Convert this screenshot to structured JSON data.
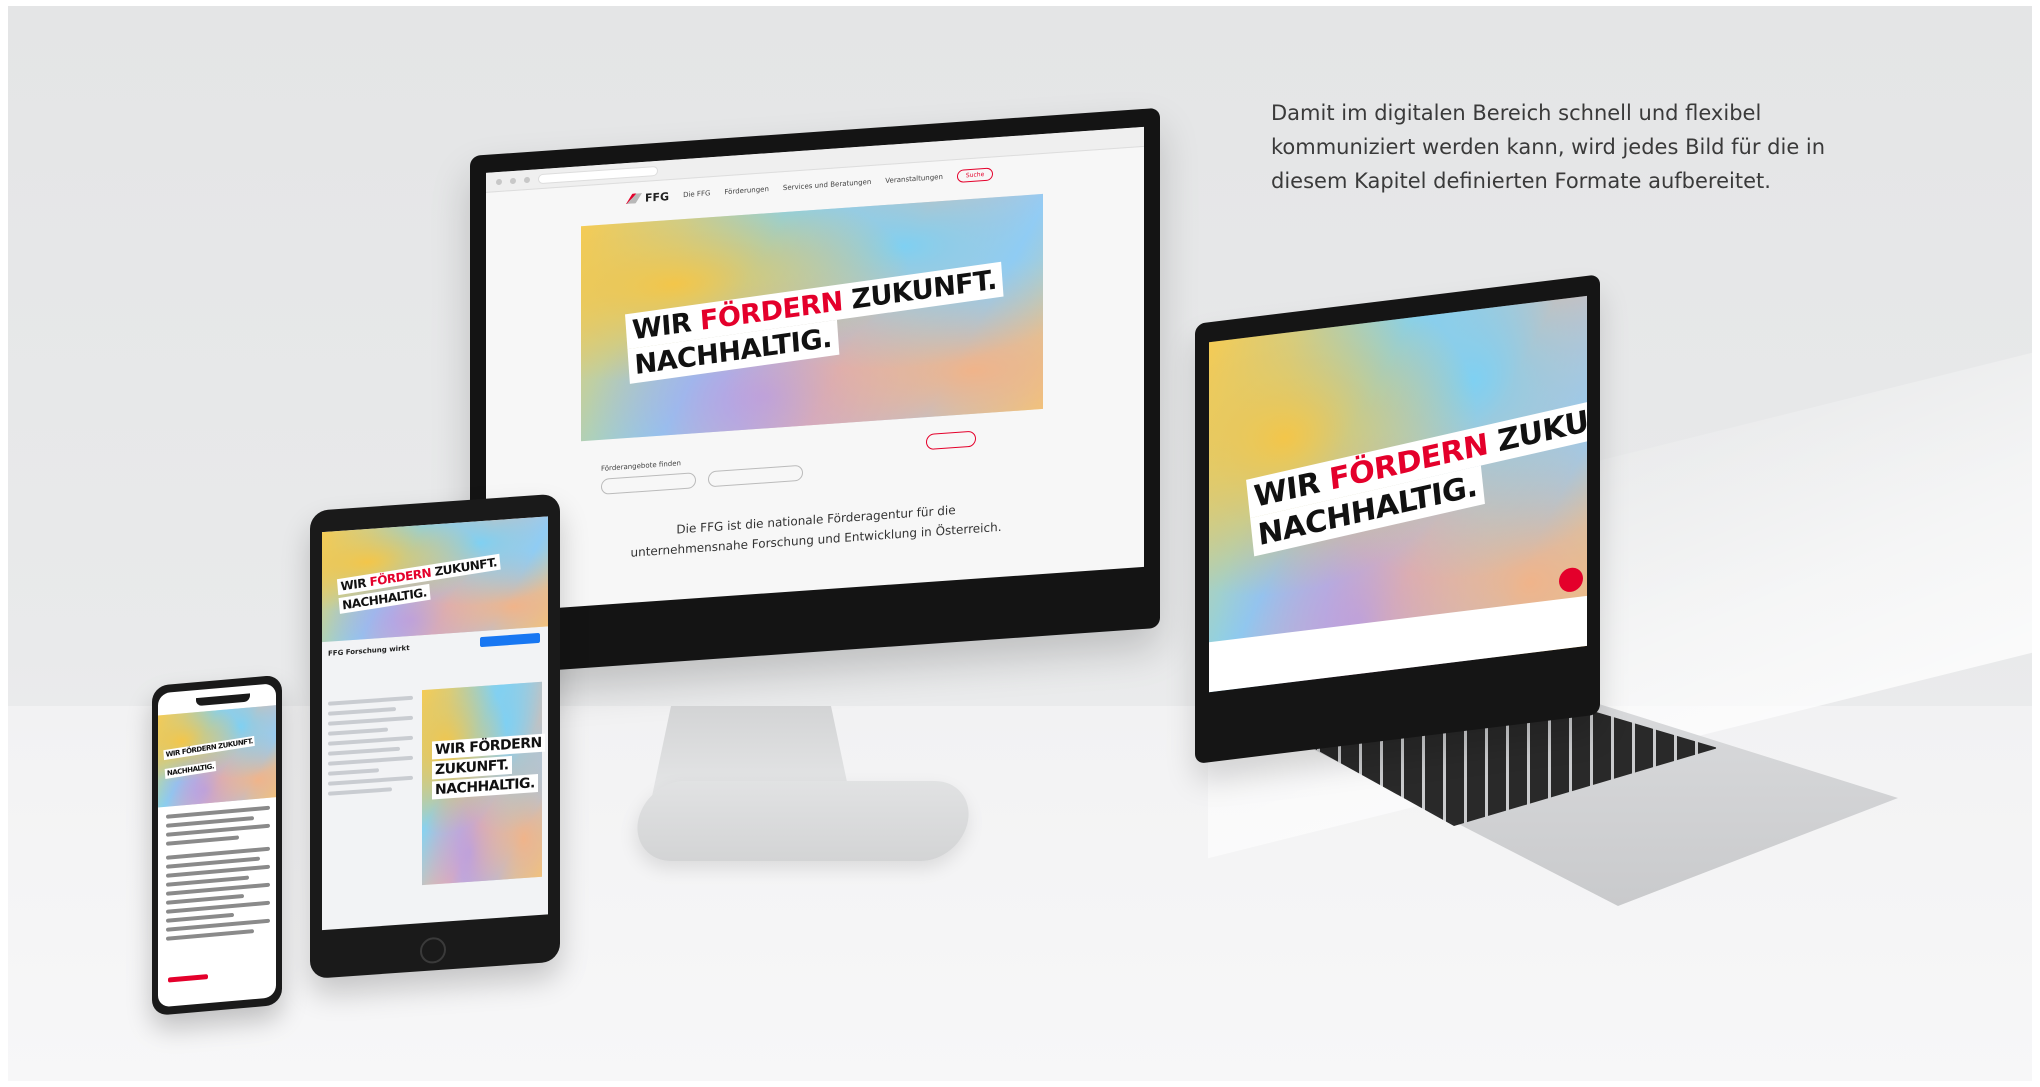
{
  "caption": {
    "line1": "Damit im digitalen Bereich schnell und flexibel",
    "line2": "kommuniziert werden kann, wird jedes Bild für die in",
    "line3": "diesem Kapitel definierten Formate aufbereitet."
  },
  "headline": {
    "word1": "WIR",
    "word2": "FÖRDERN",
    "word3": "ZUKUNFT.",
    "line2": "NACHHALTIG."
  },
  "monitor": {
    "logo": "FFG",
    "nav": [
      "Die FFG",
      "Förderungen",
      "Services und Beratungen",
      "Veranstaltungen"
    ],
    "nav_button": "Suche",
    "search_label": "Förderangebote finden",
    "tagline": "Die FFG ist die nationale Förderagentur für die unternehmensnahe Forschung und Entwicklung in Österreich."
  },
  "tablet": {
    "page_name": "FFG Forschung wirkt",
    "post_line1": "WIR FÖRDERN",
    "post_line2": "ZUKUNFT.",
    "post_line3": "NACHHALTIG."
  },
  "phone": {
    "hl1": "WIR FÖRDERN ZUKUNFT.",
    "hl2": "NACHHALTIG."
  },
  "colors": {
    "brand_red": "#e4002b",
    "facebook_blue": "#1877f2"
  }
}
